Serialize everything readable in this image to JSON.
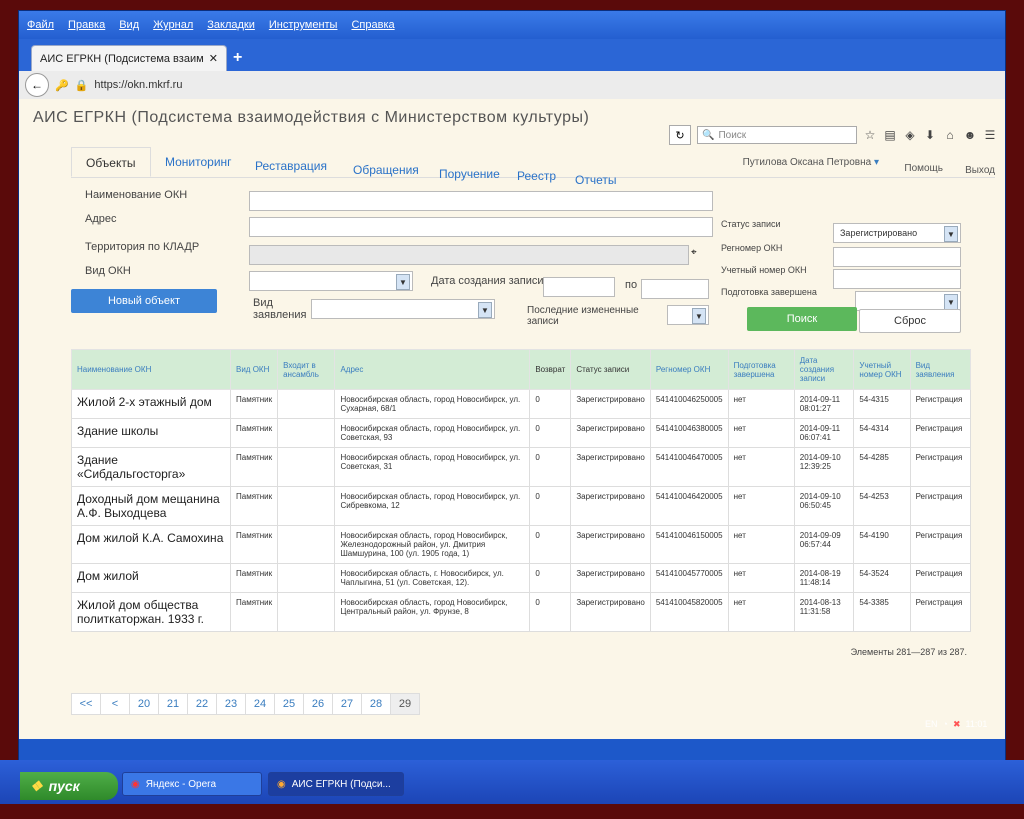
{
  "menubar": [
    "Файл",
    "Правка",
    "Вид",
    "Журнал",
    "Закладки",
    "Инструменты",
    "Справка"
  ],
  "browser": {
    "tab_title": "АИС ЕГРКН (Подсистема взаим...",
    "url": "https://okn.mkrf.ru",
    "search_placeholder": "Поиск"
  },
  "app": {
    "title": "АИС ЕГРКН (Подсистема взаимодействия с Министерством культуры)",
    "tabs": [
      "Объекты",
      "Мониторинг",
      "Реставрация",
      "Обращения",
      "Поручение",
      "Реестр",
      "Отчеты"
    ],
    "user": "Путилова Оксана Петровна",
    "help": "Помощь",
    "exit": "Выход"
  },
  "form": {
    "name_label": "Наименование ОКН",
    "address_label": "Адрес",
    "territory_label": "Территория по КЛАДР",
    "type_label": "Вид ОКН",
    "date_from_label": "Дата создания записи с",
    "date_to_label": "по",
    "application_type_label": "Вид заявления",
    "last_changed_label": "Последние измененные записи",
    "new_object_button": "Новый объект",
    "status_label": "Статус записи",
    "status_value": "Зарегистрировано",
    "regnum_label": "Регномер ОКН",
    "accnum_label": "Учетный номер ОКН",
    "prep_label": "Подготовка завершена",
    "search_button": "Поиск",
    "reset_button": "Сброс"
  },
  "table": {
    "headers": [
      "Наименование ОКН",
      "Вид ОКН",
      "Входит в ансамбль",
      "Адрес",
      "Возврат",
      "Статус записи",
      "Регномер ОКН",
      "Подготовка завершена",
      "Дата создания записи",
      "Учетный номер ОКН",
      "Вид заявления"
    ],
    "rows": [
      {
        "name": "Жилой 2-х этажный дом",
        "type": "Памятник",
        "ensemble": "",
        "address": "Новосибирская область, город Новосибирск, ул. Сухарная, 68/1",
        "ret": "0",
        "status": "Зарегистрировано",
        "reg": "541410046250005",
        "prep": "нет",
        "date": "2014-09-11 08:01:27",
        "acc": "54-4315",
        "app": "Регистрация"
      },
      {
        "name": "Здание школы",
        "type": "Памятник",
        "ensemble": "",
        "address": "Новосибирская область, город Новосибирск, ул. Советская, 93",
        "ret": "0",
        "status": "Зарегистрировано",
        "reg": "541410046380005",
        "prep": "нет",
        "date": "2014-09-11 06:07:41",
        "acc": "54-4314",
        "app": "Регистрация"
      },
      {
        "name": "Здание «Сибдальгосторга»",
        "type": "Памятник",
        "ensemble": "",
        "address": "Новосибирская область, город Новосибирск, ул. Советская, 31",
        "ret": "0",
        "status": "Зарегистрировано",
        "reg": "541410046470005",
        "prep": "нет",
        "date": "2014-09-10 12:39:25",
        "acc": "54-4285",
        "app": "Регистрация"
      },
      {
        "name": "Доходный дом мещанина А.Ф. Выходцева",
        "type": "Памятник",
        "ensemble": "",
        "address": "Новосибирская область, город Новосибирск, ул. Сибревкома, 12",
        "ret": "0",
        "status": "Зарегистрировано",
        "reg": "541410046420005",
        "prep": "нет",
        "date": "2014-09-10 06:50:45",
        "acc": "54-4253",
        "app": "Регистрация"
      },
      {
        "name": "Дом жилой К.А. Самохина",
        "type": "Памятник",
        "ensemble": "",
        "address": "Новосибирская область, город Новосибирск, Железнодорожный район, ул. Дмитрия Шамшурина, 100 (ул. 1905 года, 1)",
        "ret": "0",
        "status": "Зарегистрировано",
        "reg": "541410046150005",
        "prep": "нет",
        "date": "2014-09-09 06:57:44",
        "acc": "54-4190",
        "app": "Регистрация"
      },
      {
        "name": "Дом жилой",
        "type": "Памятник",
        "ensemble": "",
        "address": "Новосибирская область, г. Новосибирск, ул. Чаплыгина, 51 (ул. Советская, 12).",
        "ret": "0",
        "status": "Зарегистрировано",
        "reg": "541410045770005",
        "prep": "нет",
        "date": "2014-08-19 11:48:14",
        "acc": "54-3524",
        "app": "Регистрация"
      },
      {
        "name": "Жилой дом общества политкаторжан. 1933 г.",
        "type": "Памятник",
        "ensemble": "",
        "address": "Новосибирская область, город Новосибирск, Центральный район, ул. Фрунзе, 8",
        "ret": "0",
        "status": "Зарегистрировано",
        "reg": "541410045820005",
        "prep": "нет",
        "date": "2014-08-13 11:31:58",
        "acc": "54-3385",
        "app": "Регистрация"
      }
    ],
    "counter": "Элементы 281—287 из 287."
  },
  "pager": [
    "<<",
    "<",
    "20",
    "21",
    "22",
    "23",
    "24",
    "25",
    "26",
    "27",
    "28",
    "29"
  ],
  "tray": {
    "lang": "EN",
    "time": "11:01"
  },
  "taskbar": {
    "start": "пуск",
    "tasks": [
      "Яндекс - Opera",
      "АИС ЕГРКН (Подси..."
    ]
  }
}
